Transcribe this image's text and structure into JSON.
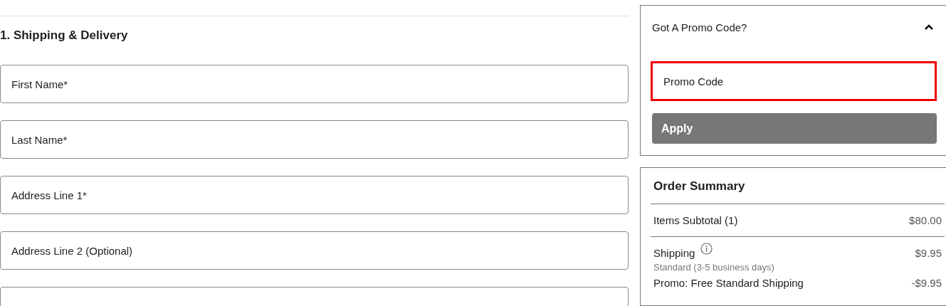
{
  "shipping": {
    "heading": "1. Shipping & Delivery",
    "fields": [
      {
        "kind": "text",
        "placeholder": "First Name*"
      },
      {
        "kind": "text",
        "placeholder": "Last Name*"
      },
      {
        "kind": "text",
        "placeholder": "Address Line 1*"
      },
      {
        "kind": "text",
        "placeholder": "Address Line 2 (Optional)"
      },
      {
        "kind": "cut"
      }
    ]
  },
  "promo": {
    "title": "Got A Promo Code?",
    "expanded": true,
    "placeholder": "Promo Code",
    "highlighted": true,
    "button": "Apply"
  },
  "order_summary": {
    "title": "Order Summary",
    "rows": [
      {
        "kind": "line",
        "label": "Items Subtotal (1)",
        "amount": "$80.00"
      },
      {
        "kind": "info",
        "label": "Shipping",
        "note": "Standard (3-5 business days)",
        "amount": "$9.95"
      },
      {
        "kind": "plain",
        "label": "Promo: Free Standard Shipping",
        "amount": "-$9.95"
      }
    ]
  }
}
